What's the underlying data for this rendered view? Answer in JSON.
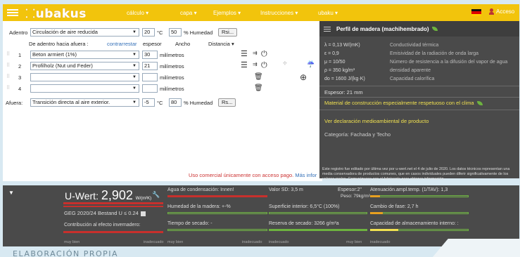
{
  "nav": {
    "menu": [
      {
        "label": "cálculo",
        "caret": "▾"
      },
      {
        "label": "capa",
        "caret": "▾"
      },
      {
        "label": "Ejemplos",
        "caret": "▾"
      },
      {
        "label": "Instrucciones",
        "caret": "▾"
      },
      {
        "label": "ubaku",
        "caret": "▾"
      }
    ],
    "logo": "ubakus",
    "account": "Acceso"
  },
  "inside": {
    "label": "Adentro",
    "select": "Circulación de aire reducida",
    "temp": "20",
    "temp_unit": "°C",
    "humidity": "50",
    "humidity_unit": "% Humedad",
    "rsi": "Rsi..."
  },
  "header_row": {
    "direction": "De adentro hacia afuera :",
    "reverse": "contrarrestar",
    "thickness": "espesor",
    "width": "Ancho",
    "distance": "Distancia"
  },
  "layers": [
    {
      "n": "1",
      "material": "Beton armiert (1%)",
      "thickness": "30",
      "unit": "milímetros"
    },
    {
      "n": "2",
      "material": "Profilholz (Nut und Feder)",
      "thickness": "21",
      "unit": "milímetros"
    },
    {
      "n": "3",
      "material": "",
      "thickness": "",
      "unit": "milímetros"
    },
    {
      "n": "4",
      "material": "",
      "thickness": "",
      "unit": "milímetros"
    }
  ],
  "outside": {
    "label": "Afuera:",
    "select": "Transición directa al aire exterior.",
    "temp": "-5",
    "temp_unit": "°C",
    "humidity": "80",
    "humidity_unit": "% Humedad",
    "rse": "Rs..."
  },
  "footer": {
    "text": "Uso comercial únicamente con acceso pago.",
    "link": "Más infor"
  },
  "panel": {
    "title": "Perfil de madera (machihembrado)",
    "props": [
      {
        "k": "λ  = 0,13 W/(mK)",
        "d": "Conductividad térmica"
      },
      {
        "k": "ε  = 0,9",
        "d": "Emisividad de la radiación de onda larga"
      },
      {
        "k": "μ  = 10/50",
        "d": "Número de resistencia a la difusión del vapor de agua"
      },
      {
        "k": "ρ  = 350 kg/m³",
        "d": "densidad aparente"
      },
      {
        "k": "do = 1600 J/(kg·K)",
        "d": "Capacidad calorífica"
      }
    ],
    "thickness": "Espesor: 21 mm",
    "eco": "Material de construcción especialmente respetuoso con el clima",
    "epd": "Ver declaración medioambiental de producto",
    "category": "Categoría: Fachada y Techo",
    "note": "Este registro fue editado por última vez por u-wert.net el 4 de julio de 2020. Los datos técnicos representan una media conservadora de productos comunes, que en casos individuales pueden diferir significativamente de los valores reales. Comuníquese con el fabricante para obtener información."
  },
  "results": {
    "uwert_label": "U-Wert:",
    "uwert_value": "2,902",
    "uwert_unit": "W/(m²K)",
    "geg": "GEG 2020/24 Bestand U ≤ 0.24",
    "climate": "Contribución al efecto invernadero:",
    "scale_good": "muy bien",
    "scale_bad": "inadecuado",
    "cond": "Agua de condensación: Innen!",
    "wood_humidity": "Humedad de la madera: +-%",
    "drying": "Tiempo de secado: -",
    "sd": "Valor SD: 3,5 m",
    "thickness": "Espesor:2\"",
    "weight": "Peso: 79kg/m²",
    "surface": "Superficie interior: 6,5°C (100%)",
    "drying_reserve": "Reserva de secado: 3266 g/m²a",
    "amplitude": "Atenuación.ampl.temp. (1/TAV): 1,3",
    "phase": "Cambio de fase: 2,7 h",
    "heat_storage": "Capacidad de almacenamiento interno: :",
    "tri": "▼"
  },
  "caption": "ELABORACIÓN PROPIA",
  "colors": {
    "topbar": "#f2c40c",
    "panel": "#4a4a4a",
    "bad": "#c8302c",
    "ok": "#6db33f",
    "warn": "#e8a020"
  }
}
